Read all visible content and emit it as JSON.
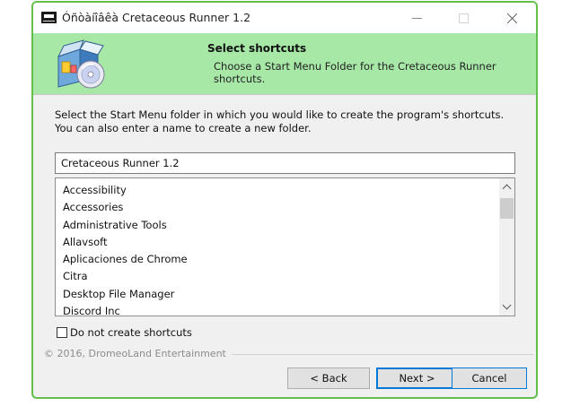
{
  "window": {
    "title": "Óñòàíîâêà Cretaceous Runner 1.2",
    "border_color": "#61c04c"
  },
  "header": {
    "title": "Select shortcuts",
    "subtitle": "Choose a Start Menu Folder for the Cretaceous Runner shortcuts.",
    "background_color": "#a7e8a7",
    "icon": "installer-box-cd-icon"
  },
  "body": {
    "instruction": "Select the Start Menu folder in which you would like to create the program's shortcuts. You can also enter a name to create a new folder.",
    "folder_input_value": "Cretaceous Runner 1.2",
    "folders": [
      "Accessibility",
      "Accessories",
      "Administrative Tools",
      "Allavsoft",
      "Aplicaciones de Chrome",
      "Citra",
      "Desktop File Manager",
      "Discord Inc"
    ],
    "no_shortcuts_label": "Do not create shortcuts",
    "no_shortcuts_checked": false
  },
  "footer": {
    "copyright": "© 2016, DromeoLand Entertainment",
    "back_label": "< Back",
    "next_label": "Next >",
    "cancel_label": "Cancel",
    "accent_color": "#0078d7"
  }
}
